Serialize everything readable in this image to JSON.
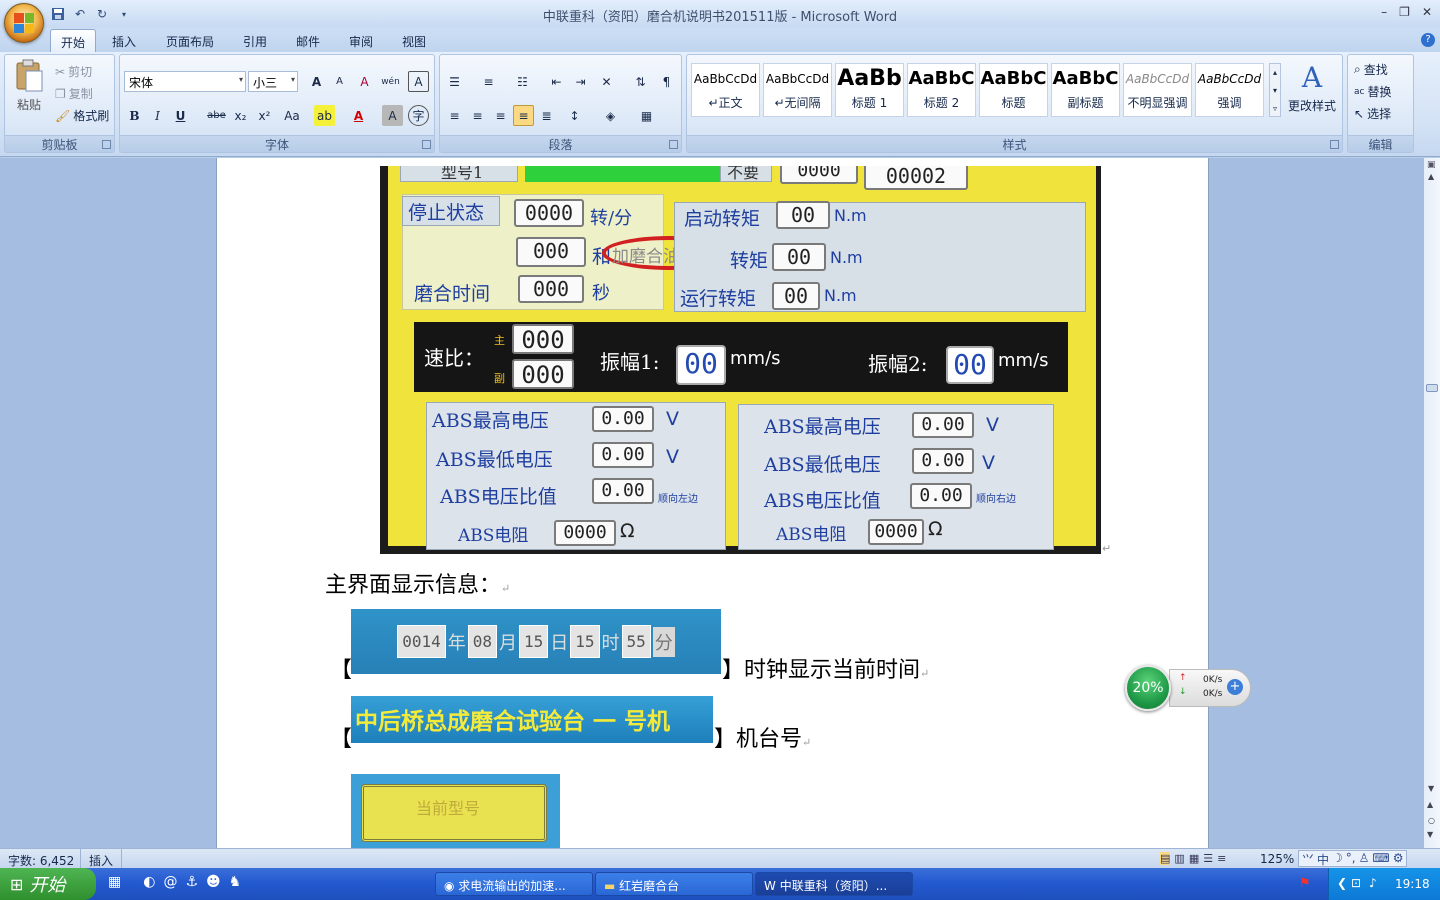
{
  "window": {
    "title": "中联重科（资阳）磨合机说明书201511版 - Microsoft Word",
    "controls": [
      "–",
      "❐",
      "✕"
    ]
  },
  "qat": {
    "save": "save-icon",
    "undo": "undo-icon",
    "redo": "redo-icon"
  },
  "tabs": [
    "开始",
    "插入",
    "页面布局",
    "引用",
    "邮件",
    "审阅",
    "视图"
  ],
  "ribbon": {
    "clipboard": {
      "paste": "粘贴",
      "cut": "剪切",
      "copy": "复制",
      "format_painter": "格式刷",
      "label": "剪贴板"
    },
    "font": {
      "name": "宋体",
      "size": "小三",
      "label": "字体",
      "bold": "B",
      "italic": "I",
      "underline": "U",
      "strike": "abe",
      "sub": "x₂",
      "sup": "x²",
      "case": "Aa",
      "grow": "A",
      "shrink": "A",
      "clear": "A",
      "phonetic": "wén",
      "border": "A"
    },
    "paragraph": {
      "label": "段落"
    },
    "styles": {
      "label": "样式",
      "items": [
        {
          "preview": "AaBbCcDd",
          "name": "↵正文"
        },
        {
          "preview": "AaBbCcDd",
          "name": "↵无间隔"
        },
        {
          "preview": "AaBb",
          "name": "标题 1"
        },
        {
          "preview": "AaBbC",
          "name": "标题 2"
        },
        {
          "preview": "AaBbC",
          "name": "标题"
        },
        {
          "preview": "AaBbC",
          "name": "副标题"
        },
        {
          "preview": "AaBbCcDd",
          "name": "不明显强调"
        },
        {
          "preview": "AaBbCcDd",
          "name": "强调"
        }
      ],
      "change": "更改样式"
    },
    "editing": {
      "find": "查找",
      "replace": "替换",
      "select": "选择",
      "label": "编辑"
    }
  },
  "photo": {
    "top_row": {
      "model_label": "型号1",
      "no": "不要",
      "v1": "0000",
      "v2": "00002"
    },
    "stop_state": {
      "label": "停止状态",
      "value": "0000",
      "unit": "转/分"
    },
    "oil_hint": "加磨合油提示",
    "row2_value": "000",
    "row2_char": "和",
    "run_time": {
      "label": "磨合时间",
      "value": "000",
      "unit": "秒"
    },
    "start_torque": {
      "label": "启动转矩",
      "value": "00",
      "unit": "N.m"
    },
    "mid_torque": {
      "label": "转矩",
      "value": "00",
      "unit": "N.m"
    },
    "run_torque": {
      "label": "运行转矩",
      "value": "00",
      "unit": "N.m"
    },
    "speed_ratio": {
      "label": "速比：",
      "main": "主",
      "sub": "副",
      "main_val": "000",
      "sub_val": "000"
    },
    "amp1": {
      "label": "振幅1:",
      "value": "00",
      "unit": "mm/s"
    },
    "amp2": {
      "label": "振幅2:",
      "value": "00",
      "unit": "mm/s"
    },
    "left_panel": {
      "max_v": {
        "label": "ABS最高电压",
        "value": "0.00",
        "unit": "V"
      },
      "min_v": {
        "label": "ABS最低电压",
        "value": "0.00",
        "unit": "V"
      },
      "ratio": {
        "label": "ABS电压比值",
        "value": "0.00",
        "note": "顺向左边"
      },
      "res": {
        "label": "ABS电阻",
        "value": "0000",
        "unit": "Ω"
      }
    },
    "right_panel": {
      "max_v": {
        "label": "ABS最高电压",
        "value": "0.00",
        "unit": "V"
      },
      "min_v": {
        "label": "ABS最低电压",
        "value": "0.00",
        "unit": "V"
      },
      "ratio": {
        "label": "ABS电压比值",
        "value": "0.00",
        "note": "顺向右边"
      },
      "res": {
        "label": "ABS电阻",
        "value": "0000",
        "unit": "Ω"
      }
    }
  },
  "doc": {
    "heading": "主界面显示信息：",
    "clock": {
      "bracket_l": "【",
      "bracket_r": "】",
      "text": "时钟显示当前时间",
      "cells": [
        {
          "v": "0014",
          "u": "年"
        },
        {
          "v": "08",
          "u": "月"
        },
        {
          "v": "15",
          "u": "日"
        },
        {
          "v": "15",
          "u": "时"
        },
        {
          "v": "55",
          "u": "分"
        }
      ]
    },
    "machine": {
      "bracket_l": "【",
      "bracket_r": "】",
      "banner": "中后桥总成磨合试验台 一 号机",
      "text": "机台号"
    },
    "model_btn": "当前型号",
    "para_mark": "↵"
  },
  "widget": {
    "percent": "20%",
    "up": "0K/s",
    "down": "0K/s"
  },
  "status": {
    "words": "字数: 6,452",
    "mode": "插入",
    "zoom": "125%"
  },
  "taskbar": {
    "start": "开始",
    "tasks": [
      "求电流输出的加速...",
      "红岩磨合台",
      "中联重科（资阳）..."
    ],
    "time": "19:18"
  }
}
